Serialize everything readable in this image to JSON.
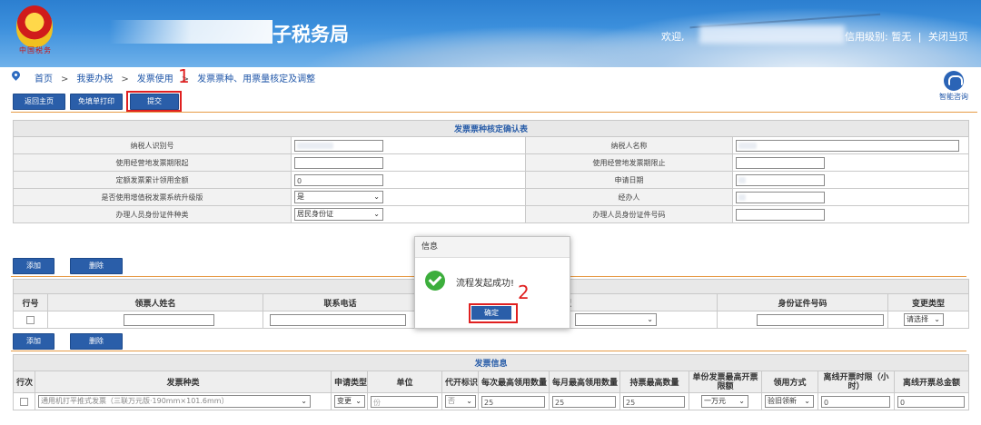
{
  "header": {
    "emblem_caption": "中国税务",
    "site_title": "子税务局",
    "welcome": "欢迎,",
    "credit_level": "信用级别: 暂无",
    "close_link": "关闭当页",
    "divider": "|"
  },
  "breadcrumb": {
    "items": [
      "首页",
      "我要办税",
      "发票使用",
      "发票票种、用票量核定及调整"
    ],
    "sep": ">"
  },
  "help": {
    "label": "智能咨询"
  },
  "toolbar": {
    "home": "返回主页",
    "print": "免填单打印",
    "submit": "提交"
  },
  "annotations": {
    "one": "1",
    "two": "2"
  },
  "confirm_table": {
    "caption": "发票票种核定确认表",
    "rows": [
      {
        "l1": "纳税人识别号",
        "v1": "",
        "l2": "纳税人名称",
        "v2": ""
      },
      {
        "l1": "使用经营地发票期限起",
        "v1": "",
        "l2": "使用经营地发票期限止",
        "v2": ""
      },
      {
        "l1": "定额发票累计领用金额",
        "v1": "0",
        "l2": "申请日期",
        "v2": ""
      },
      {
        "l1": "是否使用增值税发票系统升级版",
        "v1": "是",
        "l2": "经办人",
        "v2": ""
      },
      {
        "l1": "办理人员身份证件种类",
        "v1": "居民身份证",
        "l2": "办理人员身份证件号码",
        "v2": ""
      }
    ]
  },
  "section1": {
    "add": "添加",
    "delete": "删除"
  },
  "receiver_table": {
    "headers": [
      "行号",
      "领票人姓名",
      "联系电话",
      "型",
      "身份证件号码",
      "变更类型"
    ],
    "row": {
      "change_type": "请选择"
    }
  },
  "section2": {
    "add": "添加",
    "delete": "删除"
  },
  "invoice_table": {
    "caption": "发票信息",
    "headers": [
      "行次",
      "发票种类",
      "申请类型",
      "单位",
      "代开标识",
      "每次最高领用数量",
      "每月最高领用数量",
      "持票最高数量",
      "单份发票最高开票限额",
      "领用方式",
      "离线开票时限（小时）",
      "离线开票总金额"
    ],
    "row": {
      "type": "通用机打平推式发票（三联万元版·190mm×101.6mm）",
      "apply": "变更",
      "unit": "份",
      "proxy": "否",
      "per_time": "25",
      "per_month": "25",
      "max_hold": "25",
      "limit": "一万元",
      "method": "验旧领新",
      "offline_hours": "0",
      "offline_amount": "0"
    }
  },
  "dialog": {
    "title": "信息",
    "message": "流程发起成功!",
    "ok": "确定"
  },
  "colors": {
    "primary": "#2a5ea9",
    "annotation": "#e02020",
    "success": "#3cae3c"
  }
}
